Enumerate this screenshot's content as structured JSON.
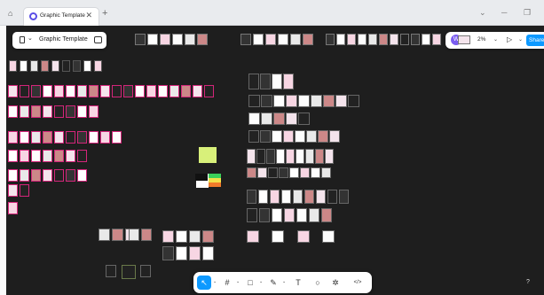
{
  "browser": {
    "tab_title": "Graphic Template",
    "home_icon": "home-icon",
    "close_icon": "close-icon",
    "new_tab_icon": "plus-icon",
    "new_tab_glyph": "+",
    "close_glyph": "✕",
    "minimize_glyph": "─",
    "restore_glyph": "❐",
    "dropdown_glyph": "⌄"
  },
  "file": {
    "title": "Graphic Template",
    "chevron": "⌄"
  },
  "collab": {
    "avatar_letter": "W",
    "zoom": "2%",
    "play_glyph": "▷",
    "share_label": "Share",
    "chevron": "⌄"
  },
  "toolbar": {
    "tools": [
      {
        "name": "move-tool",
        "glyph": "↖",
        "active": true
      },
      {
        "name": "frame-tool",
        "glyph": "#",
        "active": false
      },
      {
        "name": "shape-tool",
        "glyph": "□",
        "active": false
      },
      {
        "name": "pen-tool",
        "glyph": "✎",
        "active": false
      },
      {
        "name": "text-tool",
        "glyph": "T",
        "active": false
      },
      {
        "name": "comment-tool",
        "glyph": "○",
        "active": false
      },
      {
        "name": "actions-tool",
        "glyph": "✲",
        "active": false
      },
      {
        "name": "dev-mode-tool",
        "glyph": "</>",
        "active": false
      }
    ],
    "chevron": "⌄"
  },
  "help": "?",
  "colors": {
    "accent": "#0d99ff",
    "avatar": "#7a5cf0",
    "frame_pink": "#d4257a",
    "canvas": "#1e1e1e",
    "thumb_gray": "#9a9a9a"
  }
}
